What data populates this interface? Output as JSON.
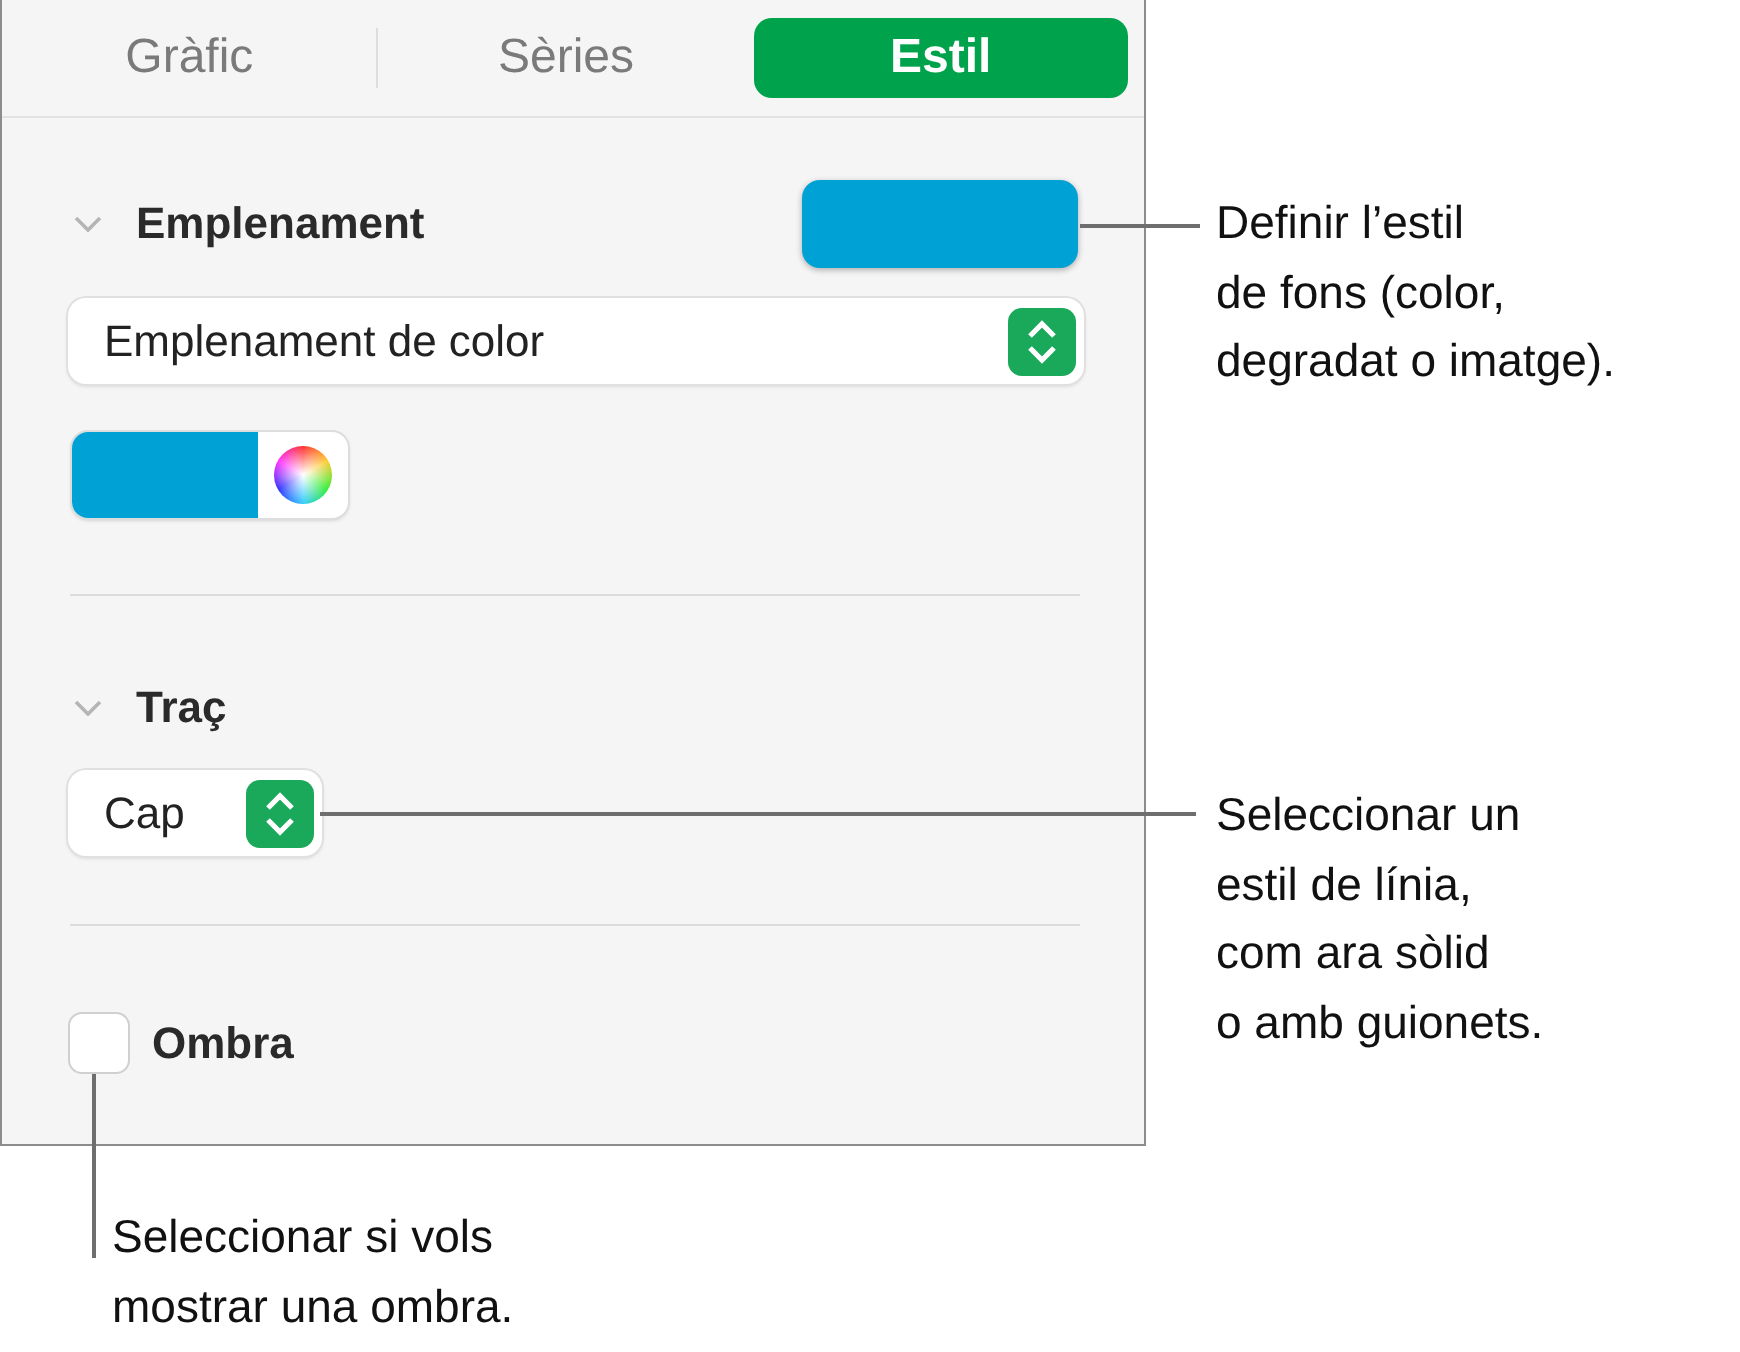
{
  "tabs": [
    {
      "label": "Gràfic",
      "selected": false
    },
    {
      "label": "Sèries",
      "selected": false
    },
    {
      "label": "Estil",
      "selected": true
    }
  ],
  "fill": {
    "title": "Emplenament",
    "expanded": true,
    "color": "#00a2d6",
    "popup": "Emplenament de color"
  },
  "stroke": {
    "title": "Traç",
    "expanded": true,
    "popup": "Cap"
  },
  "shadow": {
    "label": "Ombra",
    "checked": false
  },
  "callouts": [
    {
      "kind": "fill",
      "lines": [
        "Definir l’estil",
        "de fons (color,",
        "degradat o imatge)."
      ]
    },
    {
      "kind": "stroke",
      "lines": [
        "Seleccionar un",
        "estil de línia,",
        "com ara sòlid",
        "o amb guionets."
      ]
    },
    {
      "kind": "shadow",
      "lines": [
        "Seleccionar si vols",
        "mostrar una ombra."
      ]
    }
  ]
}
